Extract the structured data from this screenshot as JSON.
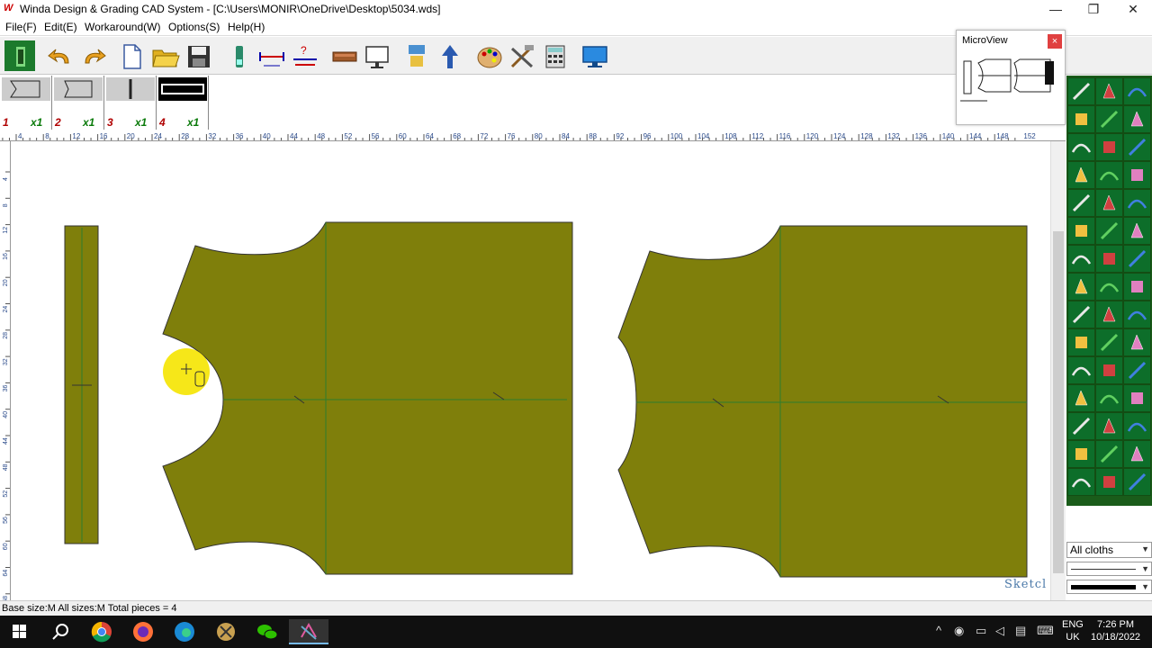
{
  "window": {
    "app_icon": "W",
    "title": "Winda Design & Grading CAD System - [C:\\Users\\MONIR\\OneDrive\\Desktop\\5034.wds]",
    "minimize": "—",
    "maximize": "❐",
    "close": "✕"
  },
  "menu": [
    "File(F)",
    "Edit(E)",
    "Workaround(W)",
    "Options(S)",
    "Help(H)"
  ],
  "toolbar_icons": [
    "pattern-icon",
    "undo-icon",
    "redo-icon",
    "new-file-icon",
    "open-folder-icon",
    "save-icon",
    "pen-tool-icon",
    "measure-icon",
    "grading-icon",
    "table-icon",
    "monitor-icon",
    "layers-icon",
    "arrow-tool-icon",
    "palette-icon",
    "tools-icon",
    "calculator-icon",
    "screen-icon"
  ],
  "pieces": [
    {
      "num": "1",
      "qty": "x1"
    },
    {
      "num": "2",
      "qty": "x1"
    },
    {
      "num": "3",
      "qty": "x1"
    },
    {
      "num": "4",
      "qty": "x1"
    }
  ],
  "microview": {
    "title": "MicroView",
    "close": "×"
  },
  "ruler": {
    "top_ticks": [
      "4",
      "8",
      "12",
      "16",
      "20",
      "24",
      "28",
      "32",
      "36",
      "40",
      "44",
      "48",
      "52",
      "56",
      "60",
      "64",
      "68",
      "72",
      "76",
      "80",
      "84",
      "88",
      "92",
      "96",
      "100",
      "104",
      "108",
      "112",
      "116",
      "120",
      "124",
      "128",
      "132",
      "136",
      "140",
      "144",
      "148",
      "152"
    ],
    "left_ticks": [
      "4",
      "8",
      "12",
      "16",
      "20",
      "24",
      "28",
      "32",
      "36",
      "40",
      "44",
      "48",
      "52",
      "56",
      "60",
      "64",
      "68"
    ]
  },
  "cloth_select": {
    "value": "All cloths"
  },
  "sketch_label": "Sketcl",
  "status": "Base size:M All sizes:M  Total pieces = 4",
  "tray": {
    "lang1": "ENG",
    "lang2": "UK",
    "time": "7:26 PM",
    "date": "10/18/2022"
  },
  "colors": {
    "fabric": "#7f7f0b",
    "palette_bg": "#0d6e2a",
    "grain": "#2e7d2e",
    "cursor": "#f5e400"
  }
}
